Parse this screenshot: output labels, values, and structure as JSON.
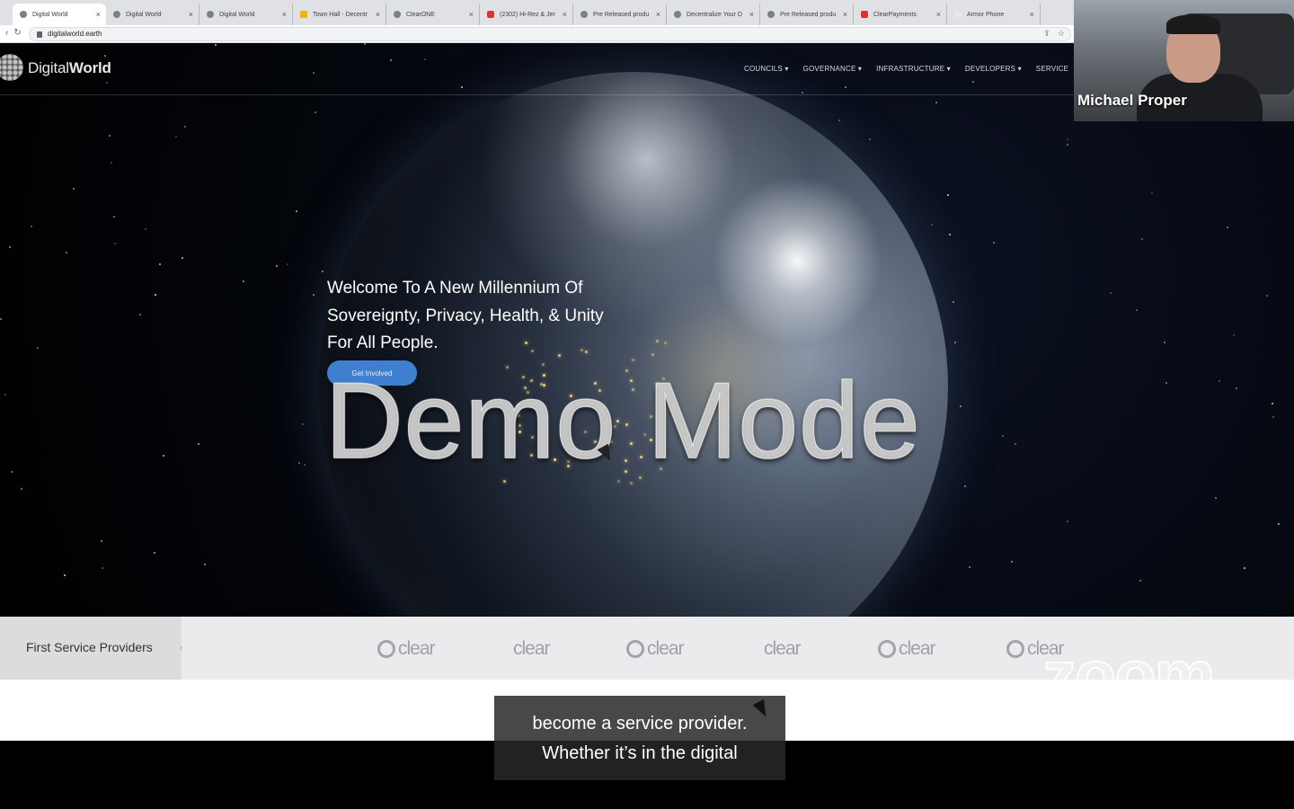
{
  "browser": {
    "tabs": [
      {
        "label": "Digital World",
        "active": true,
        "fav": "globe"
      },
      {
        "label": "Digital World",
        "active": false,
        "fav": "globe"
      },
      {
        "label": "Digital World",
        "active": false,
        "fav": "globe"
      },
      {
        "label": "Town Hall - Decentr",
        "active": false,
        "fav": "folder"
      },
      {
        "label": "ClearONE",
        "active": false,
        "fav": "globe"
      },
      {
        "label": "(2302) Hi-Rez & Jer",
        "active": false,
        "fav": "youtube"
      },
      {
        "label": "Pre Released produ",
        "active": false,
        "fav": "globe"
      },
      {
        "label": "Decentralize Your D",
        "active": false,
        "fav": "globe"
      },
      {
        "label": "Pre Released produ",
        "active": false,
        "fav": "globe"
      },
      {
        "label": "ClearPayments",
        "active": false,
        "fav": "clear"
      },
      {
        "label": "Armor Phone",
        "active": false,
        "fav": "blank"
      }
    ],
    "url": "digitalworld.earth"
  },
  "site": {
    "logo_prefix": "Digital",
    "logo_suffix": "World",
    "nav": [
      "COUNCILS ▾",
      "GOVERNANCE ▾",
      "INFRASTRUCTURE ▾",
      "DEVELOPERS ▾",
      "SERVICE"
    ],
    "hero_lines": [
      "Welcome To A New Millennium Of",
      "Sovereignty, Privacy, Health, & Unity",
      "For All People."
    ],
    "cta": "Get Involved"
  },
  "providers": {
    "label": "First Service Providers",
    "items": [
      "clear",
      "clear",
      "clear",
      "clear",
      "clear",
      "clear"
    ]
  },
  "watermarks": {
    "demo": "Demo Mode",
    "zoom": "zoom"
  },
  "caption": {
    "lines": [
      "become a service provider.",
      "Whether it’s in the digital"
    ]
  },
  "participant": {
    "name": "Michael Proper"
  }
}
